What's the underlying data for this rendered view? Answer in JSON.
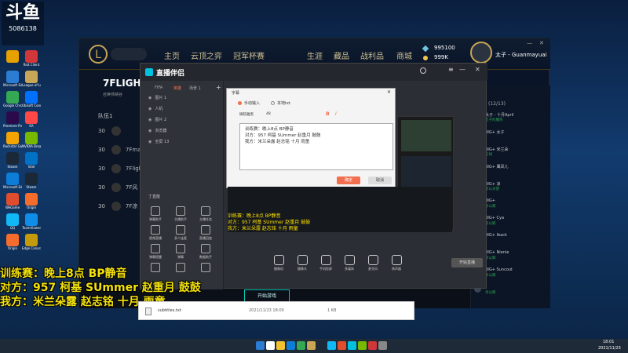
{
  "stream_logo": {
    "brand": "斗鱼",
    "room": "5086138"
  },
  "desktop": {
    "icons": [
      {
        "label": "",
        "color": "#e6a000"
      },
      {
        "label": "Microsoft Edge",
        "color": "#2b7cd3"
      },
      {
        "label": "Google Chrome",
        "color": "#34a853"
      },
      {
        "label": "Premiere Pro",
        "color": "#2a0a4a"
      },
      {
        "label": "Rockstar Games",
        "color": "#f4a300"
      },
      {
        "label": "Steam",
        "color": "#1b2838"
      },
      {
        "label": "Microsoft Edge",
        "color": "#0c7ed8"
      },
      {
        "label": "WeGame",
        "color": "#e04d2e"
      },
      {
        "label": "QQ",
        "color": "#12b7f5"
      },
      {
        "label": "Origin",
        "color": "#f56c2d"
      },
      {
        "label": "Riot Client",
        "color": "#d13639"
      },
      {
        "label": "League of Legends",
        "color": "#c8a655"
      },
      {
        "label": "Ubisoft Connect",
        "color": "#0070ff"
      },
      {
        "label": "EA",
        "color": "#ff4747"
      },
      {
        "label": "NVIDIA Broadcast",
        "color": "#76b900"
      },
      {
        "label": "Intel",
        "color": "#0071c5"
      },
      {
        "label": "Steam",
        "color": "#1b2838"
      },
      {
        "label": "Origin",
        "color": "#f56c2d"
      },
      {
        "label": "TeamViewer",
        "color": "#0e8ee9"
      },
      {
        "label": "Edge Canary",
        "color": "#c49a0a"
      }
    ]
  },
  "lol": {
    "search_placeholder": "",
    "nav": [
      "主页",
      "云顶之弈",
      "冠军杯赛",
      "生涯",
      "藏品",
      "战利品",
      "商城"
    ],
    "currency_be": "995100",
    "currency_rp": "999K",
    "username": "太子 - Guanmayuai",
    "team_name": "7FLIGHT",
    "team_sub": "召唤师峡谷",
    "team_label": "队伍1",
    "members": [
      {
        "level": "30",
        "name": ""
      },
      {
        "level": "30",
        "name": "7Fmai"
      },
      {
        "level": "30",
        "name": "7Fligh"
      },
      {
        "level": "30",
        "name": "7F风"
      },
      {
        "level": "30",
        "name": "7F凉"
      }
    ],
    "invite_btn": "已邀请的玩家",
    "find_match": "开始游戏",
    "friends_header": "(12/13)",
    "friends": [
      {
        "name": "太子 - 十月April",
        "status": "太子的魔阵"
      },
      {
        "name": "BIG+ 太子",
        "status": ""
      },
      {
        "name": "BIG+ 米兰朵",
        "status": "在线"
      },
      {
        "name": "BIG+ 鹰凤儿",
        "status": ""
      },
      {
        "name": "BIG+ 凉",
        "status": "凉以天使"
      },
      {
        "name": "BIG+ ",
        "status": "亲以鲸"
      },
      {
        "name": "BIG+ Cya",
        "status": "亲以鲸"
      },
      {
        "name": "BIG+ Iback",
        "status": ""
      },
      {
        "name": "BIG+ Nienie",
        "status": "亲以鲸"
      },
      {
        "name": "BIG+ Suncout",
        "status": "亲以鲸"
      },
      {
        "name": "",
        "status": "亲以鲸"
      }
    ]
  },
  "obs": {
    "title": "直播伴侣",
    "tabs": [
      "FIFA",
      "英雄",
      "场景 1"
    ],
    "sources": [
      "图片 1",
      "人机",
      "图片 2",
      "浏览器",
      "全屏 13"
    ],
    "add_label": "丁直能",
    "tools": [
      "弹幕助手",
      "主播助手",
      "主播任务",
      "视频直播",
      "多人连麦",
      "直播回放",
      "弹幕提醒",
      "弹幕",
      "数据助手",
      "",
      "",
      ""
    ],
    "bottom_tools": [
      "摄像机",
      "摄像头",
      "手机投屏",
      "多媒体",
      "麦克风",
      "扬声器"
    ],
    "start_btn": "开始直播",
    "editor": {
      "title": "字幕",
      "radio_manual": "手动输入",
      "radio_file": "本地txt",
      "font_name": "微软雅黑",
      "font_size": "48",
      "lines": [
        "训练赛：晚上8点 BP静音",
        "对方：957 柯基 SUmmer 赵重月 鼓鼓",
        "我方：米兰朵露 赵志铭 十月 雨童"
      ],
      "ok_label": "确定",
      "cancel_label": "取消"
    }
  },
  "overlay": {
    "lines": [
      "训练赛：晚上8点 BP静音",
      "对方：957 柯基 SUmmer 赵重月 鼓鼓",
      "我方：米兰朵露 赵志铭 十月 雨童"
    ]
  },
  "file_window": {
    "name": "subtitles.txt",
    "date": "2021/11/23 18:00",
    "size": "1 KB"
  },
  "taskbar": {
    "time": "18:01",
    "date": "2021/11/23"
  }
}
